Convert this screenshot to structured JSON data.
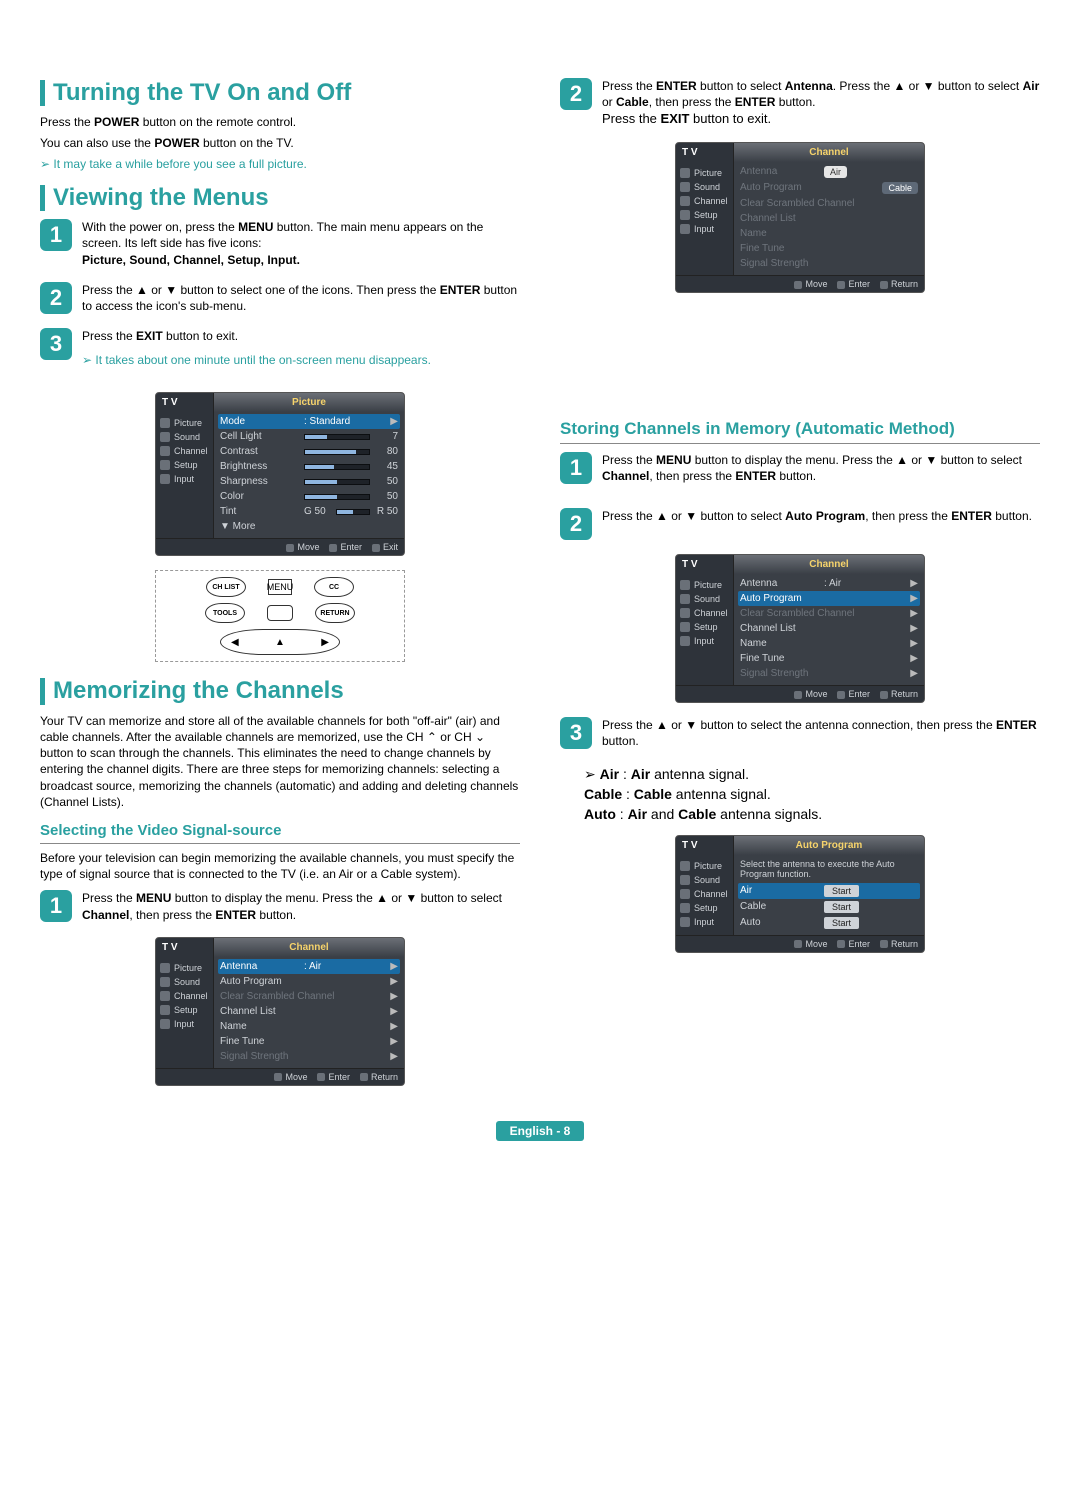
{
  "footer": {
    "text": "English - 8"
  },
  "left": {
    "sec1": {
      "heading": "Turning the TV On and Off",
      "body1": "Press the POWER button on the remote control.",
      "body2": "You can also use the POWER button on the TV.",
      "note": "It may take a while before you see a full picture."
    },
    "sec2": {
      "heading": "Viewing the Menus",
      "step1": "With the power on, press the MENU button. The main menu appears on the screen. Its left side has five icons:",
      "step1b": "Picture, Sound, Channel, Setup, Input.",
      "step2": "Press the ▲ or ▼ button to select one of the icons. Then press the ENTER button to access the icon's sub-menu.",
      "step3": "Press the EXIT button to exit.",
      "note": "It takes about one minute until the on-screen menu disappears."
    },
    "osd_picture": {
      "title": "Picture",
      "tv": "T V",
      "side": [
        "Picture",
        "Sound",
        "Channel",
        "Setup",
        "Input"
      ],
      "rows": [
        {
          "lab": "Mode",
          "val": ": Standard",
          "type": "text",
          "sel": true
        },
        {
          "lab": "Cell Light",
          "val": "7",
          "type": "bar",
          "fill": 35
        },
        {
          "lab": "Contrast",
          "val": "80",
          "type": "bar",
          "fill": 80
        },
        {
          "lab": "Brightness",
          "val": "45",
          "type": "bar",
          "fill": 45
        },
        {
          "lab": "Sharpness",
          "val": "50",
          "type": "bar",
          "fill": 50
        },
        {
          "lab": "Color",
          "val": "50",
          "type": "bar",
          "fill": 50
        },
        {
          "lab": "Tint",
          "val": "G 50",
          "val2": "R 50",
          "type": "tint",
          "fill": 50
        },
        {
          "lab": "▼ More",
          "type": "more"
        }
      ],
      "foot": [
        "Move",
        "Enter",
        "Exit"
      ]
    },
    "remote": {
      "row1": [
        "CH LIST",
        "MENU",
        "CC"
      ],
      "row2": [
        "TOOLS",
        "RETURN"
      ]
    },
    "sec3": {
      "heading": "Memorizing the Channels",
      "body": "Your TV can memorize and store all of the available channels for both \"off-air\" (air) and cable channels. After the available channels are memorized, use the CH ⌃ or CH ⌄ button to scan through the channels. This eliminates the need to change channels by entering the channel digits. There are three steps for memorizing channels: selecting a broadcast source, memorizing the channels (automatic) and adding and deleting channels (Channel Lists).",
      "sub1": "Selecting the Video Signal-source",
      "sub1_body": "Before your television can begin memorizing the available channels, you must specify the type of signal source that is connected to the TV (i.e. an Air or a Cable system).",
      "step1": "Press the MENU button to display the menu. Press the ▲ or ▼ button to select Channel, then press the ENTER button."
    },
    "osd_channel": {
      "title": "Channel",
      "tv": "T V",
      "side": [
        "Picture",
        "Sound",
        "Channel",
        "Setup",
        "Input"
      ],
      "rows": [
        {
          "lab": "Antenna",
          "val": ": Air",
          "sel": true
        },
        {
          "lab": "Auto Program"
        },
        {
          "lab": "Clear Scrambled Channel",
          "disabled": true
        },
        {
          "lab": "Channel List"
        },
        {
          "lab": "Name"
        },
        {
          "lab": "Fine Tune"
        },
        {
          "lab": "Signal Strength",
          "disabled": true
        }
      ],
      "foot": [
        "Move",
        "Enter",
        "Return"
      ]
    }
  },
  "right": {
    "step2": "Press the ENTER button to select Antenna. Press the ▲ or ▼ button to select Air or Cable, then press the ENTER button.",
    "step2b": "Press the EXIT button to exit.",
    "osd_antenna": {
      "title": "Channel",
      "tv": "T V",
      "side": [
        "Picture",
        "Sound",
        "Channel",
        "Setup",
        "Input"
      ],
      "rows": [
        {
          "lab": "Antenna",
          "pills": [
            "Air",
            "Cable"
          ],
          "sel": true
        },
        {
          "lab": "Auto Program",
          "disabled": true
        },
        {
          "lab": "Clear Scrambled Channel",
          "disabled": true
        },
        {
          "lab": "Channel List",
          "disabled": true
        },
        {
          "lab": "Name",
          "disabled": true
        },
        {
          "lab": "Fine Tune",
          "disabled": true
        },
        {
          "lab": "Signal Strength",
          "disabled": true
        }
      ],
      "foot": [
        "Move",
        "Enter",
        "Return"
      ]
    },
    "sec4": {
      "heading": "Storing Channels in Memory (Automatic Method)",
      "step1": "Press the MENU button to display the menu. Press the ▲ or ▼ button to select Channel, then press the ENTER button.",
      "step2": "Press the ▲ or ▼ button to select Auto Program, then press the ENTER button."
    },
    "osd_auto1": {
      "title": "Channel",
      "tv": "T V",
      "side": [
        "Picture",
        "Sound",
        "Channel",
        "Setup",
        "Input"
      ],
      "rows": [
        {
          "lab": "Antenna",
          "val": ": Air"
        },
        {
          "lab": "Auto Program",
          "sel": true
        },
        {
          "lab": "Clear Scrambled Channel",
          "disabled": true
        },
        {
          "lab": "Channel List"
        },
        {
          "lab": "Name"
        },
        {
          "lab": "Fine Tune"
        },
        {
          "lab": "Signal Strength",
          "disabled": true
        }
      ],
      "foot": [
        "Move",
        "Enter",
        "Return"
      ]
    },
    "step3": "Press the ▲ or ▼ button to select the antenna connection, then press the ENTER button.",
    "sig": {
      "air_l": "Air",
      "air_v": "Air antenna signal.",
      "cable_l": "Cable",
      "cable_v": "Cable antenna signal.",
      "auto_l": "Auto",
      "auto_v": "Air and Cable antenna signals."
    },
    "osd_auto2": {
      "title": "Auto Program",
      "tv": "T V",
      "side": [
        "Picture",
        "Sound",
        "Channel",
        "Setup",
        "Input"
      ],
      "intro": "Select the antenna to execute the Auto Program function.",
      "rows": [
        {
          "lab": "Air",
          "btn": "Start",
          "sel": true
        },
        {
          "lab": "Cable",
          "btn": "Start"
        },
        {
          "lab": "Auto",
          "btn": "Start"
        }
      ],
      "foot": [
        "Move",
        "Enter",
        "Return"
      ]
    }
  }
}
